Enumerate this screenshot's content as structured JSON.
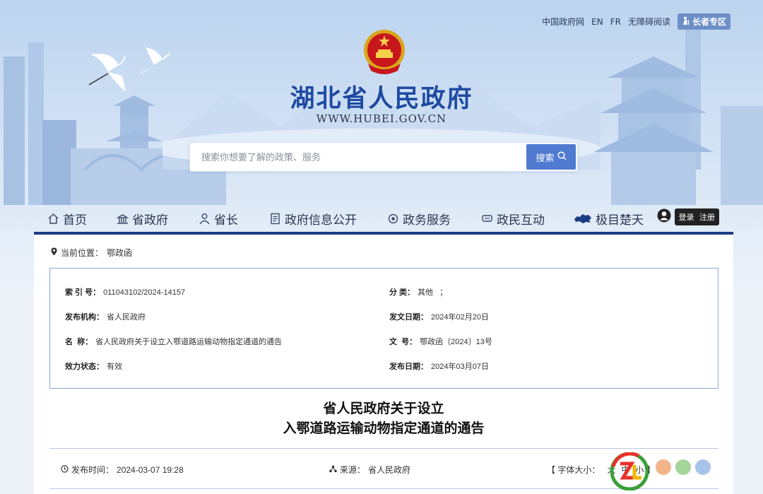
{
  "top_links": {
    "gov": "中国政府网",
    "en": "EN",
    "fr": "FR",
    "accessible": "无障碍阅读",
    "elder": "长者专区"
  },
  "site": {
    "title": "湖北省人民政府",
    "url": "WWW.HUBEI.GOV.CN"
  },
  "search": {
    "placeholder": "搜索你想要了解的政策、服务",
    "button": "搜索"
  },
  "nav": {
    "items": [
      {
        "label": "首页",
        "icon": "home-icon"
      },
      {
        "label": "省政府",
        "icon": "building-icon"
      },
      {
        "label": "省长",
        "icon": "person-icon"
      },
      {
        "label": "政府信息公开",
        "icon": "document-icon"
      },
      {
        "label": "政务服务",
        "icon": "service-icon"
      },
      {
        "label": "政民互动",
        "icon": "chat-icon"
      },
      {
        "label": "极目楚天",
        "icon": "hubei-map-icon"
      }
    ],
    "user": {
      "login": "登录",
      "register": "注册"
    }
  },
  "breadcrumb": {
    "label": "当前位置：",
    "current": "鄂政函"
  },
  "meta": {
    "index_label": "索 引 号：",
    "index_value": "011043102/2024-14157",
    "category_label": "分  类：",
    "category_value": "其他   ；",
    "publisher_label": "发布机构：",
    "publisher_value": "省人民政府",
    "issue_date_label": "发文日期：",
    "issue_date_value": "2024年02月20日",
    "name_label": "名  称：",
    "name_value": "省人民政府关于设立入鄂道路运输动物指定通道的通告",
    "docno_label": "文  号：",
    "docno_value": "鄂政函〔2024〕13号",
    "status_label": "效力状态：",
    "status_value": "有效",
    "publish_date_label": "发布日期：",
    "publish_date_value": "2024年03月07日"
  },
  "doc": {
    "title_line1": "省人民政府关于设立",
    "title_line2": "入鄂道路运输动物指定通道的通告"
  },
  "info_bar": {
    "time_label": "发布时间：",
    "time_value": "2024-03-07 19:28",
    "source_label": "来源：",
    "source_value": "省人民政府",
    "font_label": "【 字体大小：",
    "font_big": "大",
    "font_mid": "中",
    "font_small": "小",
    "font_close": "】"
  },
  "colors": {
    "nav_bar": "#1c3d84",
    "title": "#1d4aa0",
    "search_button": "#4f7ad0"
  }
}
